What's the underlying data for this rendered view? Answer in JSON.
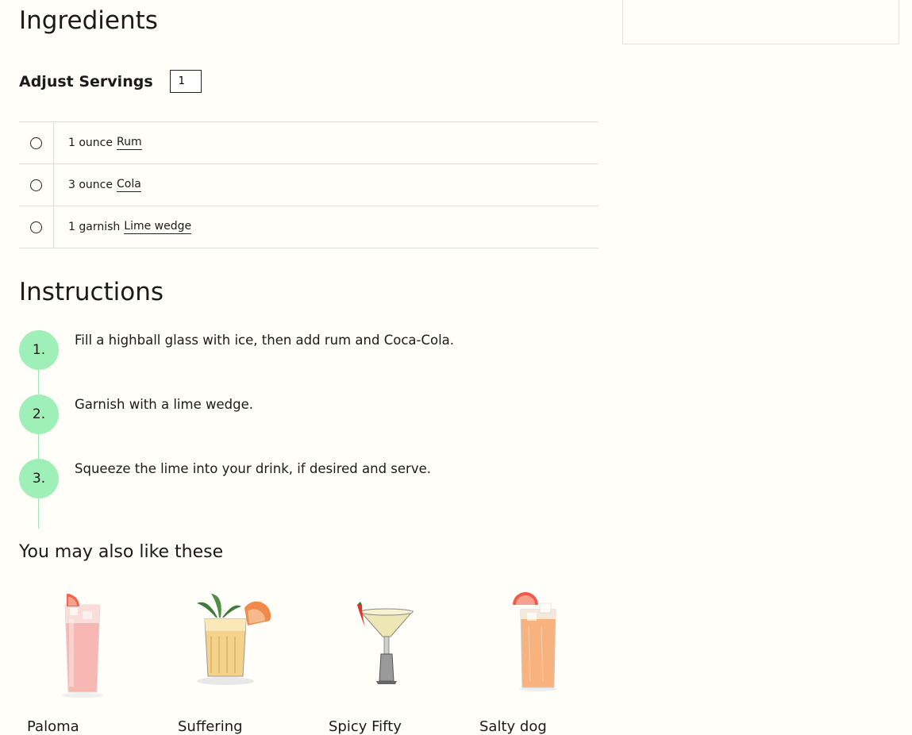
{
  "ingredients": {
    "heading": "Ingredients",
    "adjust_label": "Adjust Servings",
    "servings_value": "1",
    "items": [
      {
        "qty": "1 ounce",
        "name": "Rum"
      },
      {
        "qty": "3 ounce",
        "name": "Cola"
      },
      {
        "qty": "1 garnish",
        "name": "Lime wedge"
      }
    ]
  },
  "instructions": {
    "heading": "Instructions",
    "steps": [
      {
        "num": "1.",
        "text": "Fill a highball glass with ice, then add rum and Coca-Cola."
      },
      {
        "num": "2.",
        "text": "Garnish with a lime wedge."
      },
      {
        "num": "3.",
        "text": "Squeeze the lime into your drink, if desired and serve."
      }
    ]
  },
  "related": {
    "heading": "You may also like these",
    "cards": [
      {
        "title": "Paloma"
      },
      {
        "title": "Suffering"
      },
      {
        "title": "Spicy Fifty"
      },
      {
        "title": "Salty dog"
      }
    ]
  },
  "colors": {
    "step_circle": "#9ff0b8",
    "step_line": "#9fe4b5",
    "background": "#fffef8"
  }
}
